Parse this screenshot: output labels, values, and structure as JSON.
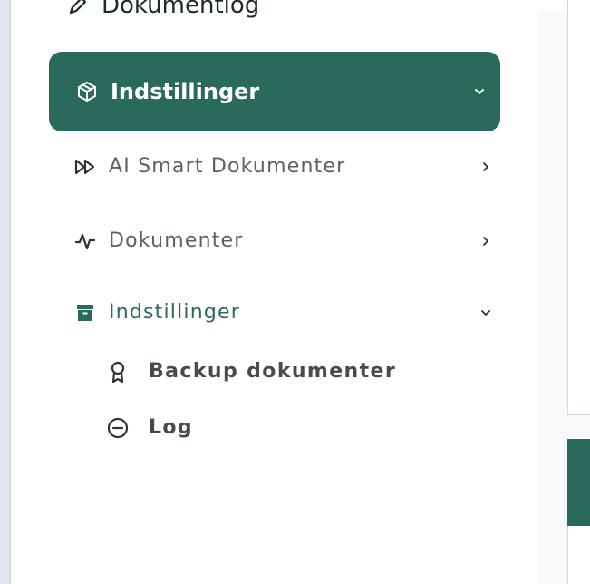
{
  "sidebar": {
    "top_item": {
      "label": "Dokumentlog",
      "icon": "pencil-icon"
    },
    "active_item": {
      "label": "Indstillinger",
      "icon": "cube-icon",
      "chevron": "chevron-down-icon"
    },
    "sub_items": [
      {
        "label": "AI Smart Dokumenter",
        "icon": "fast-forward-icon",
        "chevron": "chevron-right-icon"
      },
      {
        "label": "Dokumenter",
        "icon": "activity-icon",
        "chevron": "chevron-right-icon"
      },
      {
        "label": "Indstillinger",
        "icon": "archive-icon",
        "chevron": "chevron-down-icon"
      }
    ],
    "leaf_items": [
      {
        "label": "Backup dokumenter",
        "icon": "award-icon"
      },
      {
        "label": "Log",
        "icon": "minus-circle-icon"
      }
    ]
  },
  "colors": {
    "accent": "#2a6a5c",
    "text_muted": "#5b6266",
    "text_dark": "#1f2a2b"
  }
}
